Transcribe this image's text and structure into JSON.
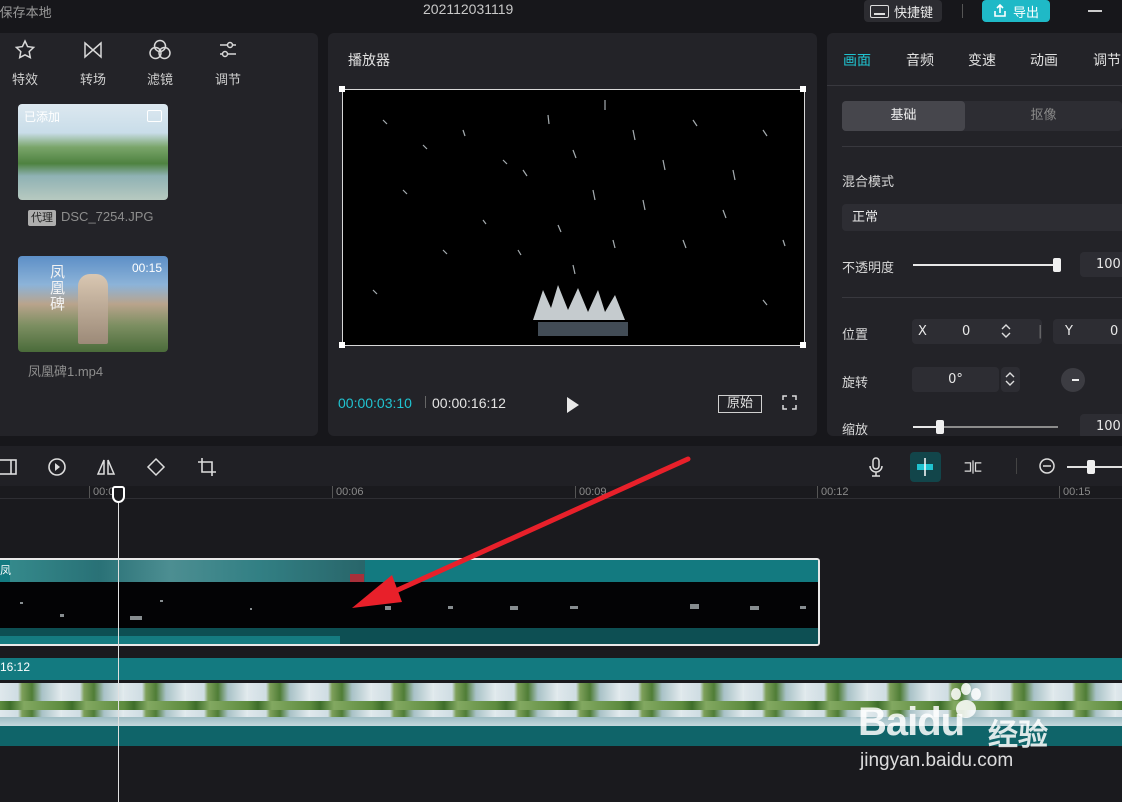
{
  "titlebar": {
    "save_status": "i保存本地",
    "project_name": "202112031119",
    "shortcut_label": "快捷键",
    "export_label": "导出"
  },
  "media_toolbar": {
    "items": [
      {
        "label": "特效",
        "icon": "effects-icon"
      },
      {
        "label": "转场",
        "icon": "transition-icon"
      },
      {
        "label": "滤镜",
        "icon": "filter-icon"
      },
      {
        "label": "调节",
        "icon": "adjust-icon"
      }
    ]
  },
  "media_items": [
    {
      "tag": "已添加",
      "proxy": "代理",
      "name": "DSC_7254.JPG"
    },
    {
      "duration": "00:15",
      "overlay": "凤凰碑",
      "name": "凤凰碑1.mp4"
    }
  ],
  "player": {
    "title": "播放器",
    "current_time": "00:00:03:10",
    "total_time": "00:00:16:12",
    "ratio_label": "原始"
  },
  "properties": {
    "tabs": [
      {
        "label": "画面",
        "active": true
      },
      {
        "label": "音频",
        "active": false
      },
      {
        "label": "变速",
        "active": false
      },
      {
        "label": "动画",
        "active": false
      },
      {
        "label": "调节",
        "active": false
      }
    ],
    "segments": {
      "basic": "基础",
      "cutout": "抠像"
    },
    "blend_mode_label": "混合模式",
    "blend_mode_value": "正常",
    "opacity_label": "不透明度",
    "opacity_value": "100",
    "opacity_level": 1.0,
    "position_label": "位置",
    "pos_x_label": "X",
    "pos_x_value": "0",
    "pos_y_label": "Y",
    "pos_y_value": "0",
    "rotation_label": "旋转",
    "rotation_value": "0°",
    "scale_label": "缩放",
    "scale_value": "100"
  },
  "timeline": {
    "ruler": [
      "00:03",
      "00:06",
      "00:09",
      "00:12",
      "00:15"
    ],
    "clip1_label": "凤",
    "clip2_duration": "16:12"
  },
  "watermark": {
    "logo": "Baidu",
    "cn": "经验",
    "url": "jingyan.baidu.com"
  },
  "colors": {
    "accent": "#20c3d0",
    "clip": "#137a80",
    "arrow": "#e8202a"
  }
}
